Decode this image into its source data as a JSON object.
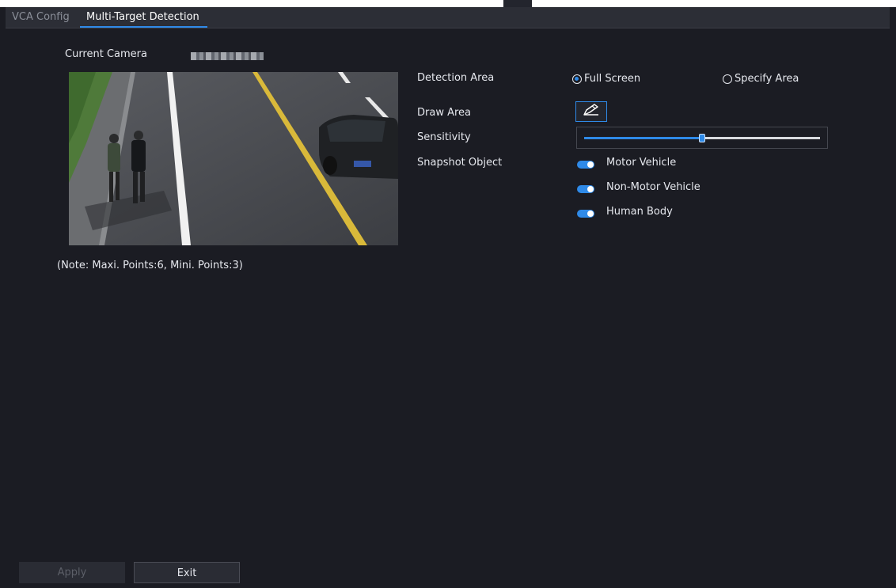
{
  "tabs": [
    {
      "label": "VCA Config",
      "active": false
    },
    {
      "label": "Multi-Target Detection",
      "active": true
    }
  ],
  "camera": {
    "label": "Current Camera"
  },
  "note": "(Note: Maxi. Points:6, Mini. Points:3)",
  "form": {
    "detection_area_label": "Detection Area",
    "detection_options": [
      {
        "label": "Full Screen",
        "selected": true
      },
      {
        "label": "Specify Area",
        "selected": false
      }
    ],
    "draw_area_label": "Draw Area",
    "draw_icon": "pencil-icon",
    "sensitivity_label": "Sensitivity",
    "sensitivity_fraction": 0.5,
    "snapshot_label": "Snapshot Object",
    "snapshot_items": [
      {
        "label": "Motor Vehicle",
        "enabled": true
      },
      {
        "label": "Non-Motor Vehicle",
        "enabled": true
      },
      {
        "label": "Human Body",
        "enabled": true
      }
    ]
  },
  "buttons": {
    "apply": "Apply",
    "exit": "Exit"
  },
  "colors": {
    "accent": "#2f8ae8",
    "background": "#1b1c23",
    "tabbar": "#2c2e36"
  }
}
